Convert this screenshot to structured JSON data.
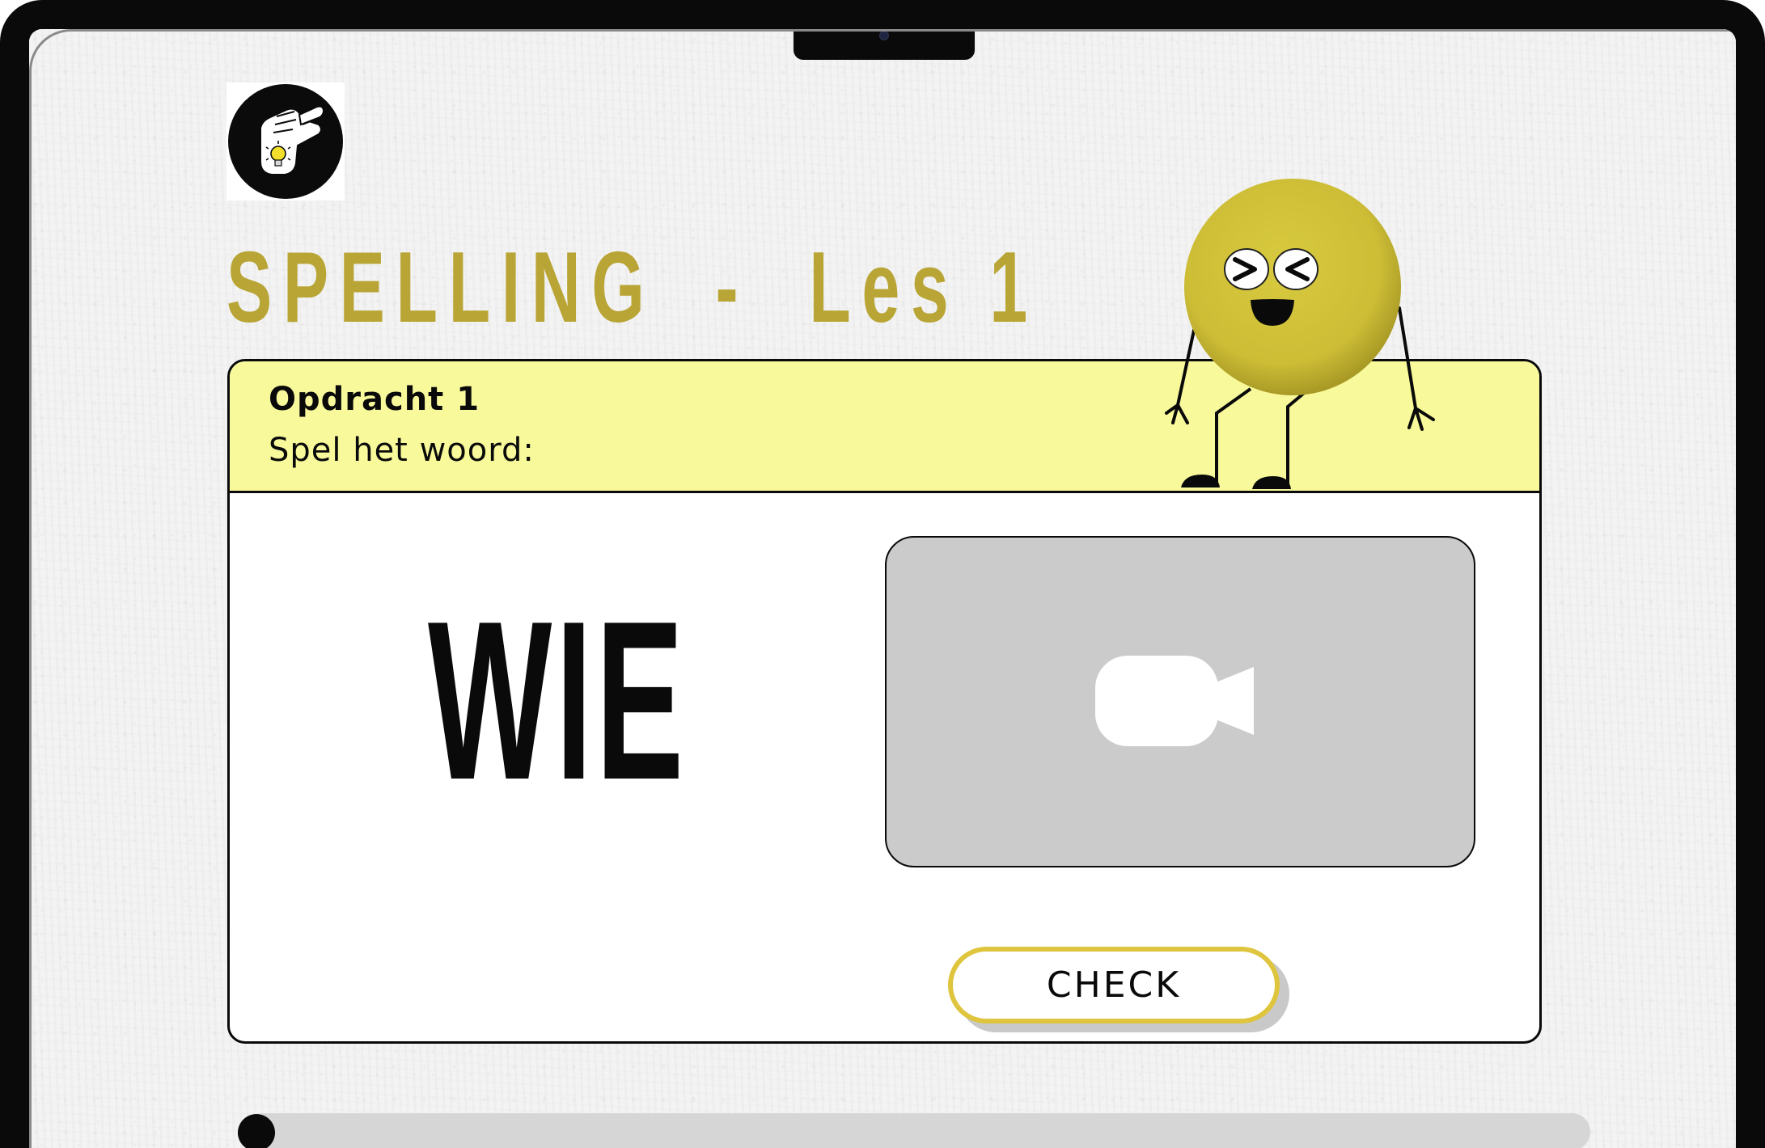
{
  "header": {
    "title": "SPELLING  -  Les 1"
  },
  "exercise": {
    "title": "Opdracht 1",
    "instruction": "Spel het woord:",
    "word": "WIE"
  },
  "buttons": {
    "check_label": "CHECK"
  },
  "progress": {
    "value": 0
  },
  "icons": {
    "logo": "pointing-hand-lightbulb-icon",
    "video": "video-camera-icon",
    "mascot": "laughing-yellow-ball-mascot"
  },
  "colors": {
    "title": "#b9a535",
    "header_band": "#f8f99b",
    "check_border": "#dfc53d",
    "mascot": "#cdbf3a",
    "video_bg": "#cbcbcb",
    "progress_track": "#d6d6d6"
  }
}
